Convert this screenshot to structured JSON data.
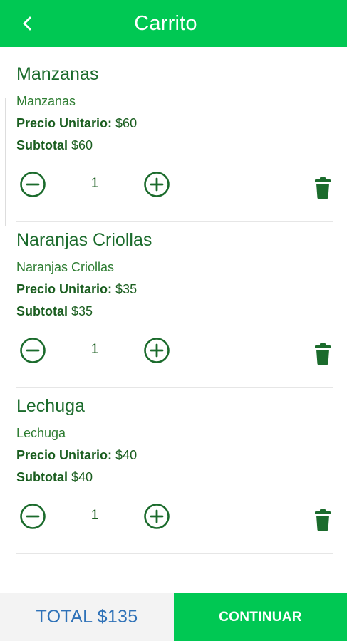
{
  "header": {
    "title": "Carrito",
    "back_icon": "chevron-left-icon"
  },
  "colors": {
    "primary": "#00c853",
    "text_green": "#1b6b2c",
    "total_blue": "#2f72b8"
  },
  "items": [
    {
      "name": "Manzanas",
      "description": "Manzanas",
      "unit_label": "Precio Unitario:",
      "unit_value": "$60",
      "subtotal_label": "Subtotal",
      "subtotal_value": "$60",
      "quantity": "1"
    },
    {
      "name": "Naranjas Criollas",
      "description": "Naranjas Criollas",
      "unit_label": "Precio Unitario:",
      "unit_value": "$35",
      "subtotal_label": "Subtotal",
      "subtotal_value": "$35",
      "quantity": "1"
    },
    {
      "name": "Lechuga",
      "description": "Lechuga",
      "unit_label": "Precio Unitario:",
      "unit_value": "$40",
      "subtotal_label": "Subtotal",
      "subtotal_value": "$40",
      "quantity": "1"
    }
  ],
  "footer": {
    "total_label": "TOTAL $135",
    "continue_label": "CONTINUAR"
  }
}
